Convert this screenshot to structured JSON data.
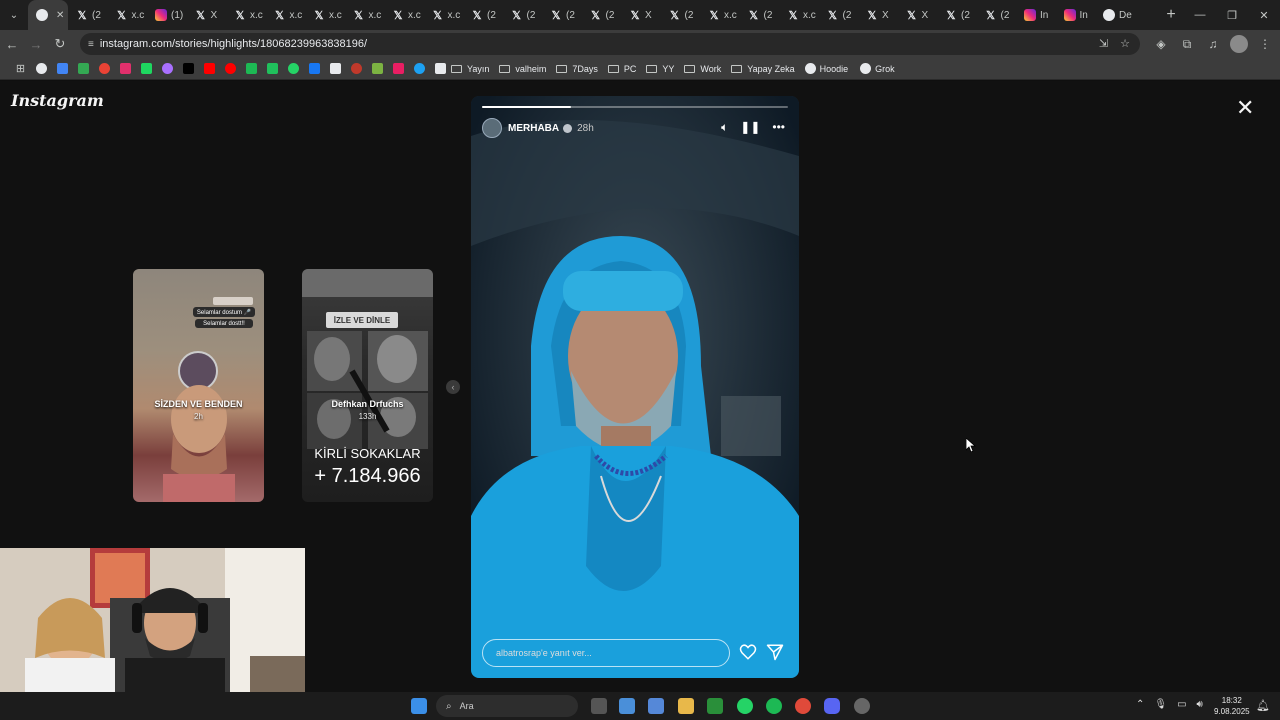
{
  "browser": {
    "tabs": [
      {
        "icon": "ch",
        "label": ""
      },
      {
        "icon": "x",
        "label": "(2"
      },
      {
        "icon": "x",
        "label": "x.c"
      },
      {
        "icon": "ig",
        "label": "(1)"
      },
      {
        "icon": "x",
        "label": "X"
      },
      {
        "icon": "x",
        "label": "x.c"
      },
      {
        "icon": "x",
        "label": "x.c"
      },
      {
        "icon": "x",
        "label": "x.c"
      },
      {
        "icon": "x",
        "label": "x.c"
      },
      {
        "icon": "x",
        "label": "x.c"
      },
      {
        "icon": "x",
        "label": "x.c"
      },
      {
        "icon": "x",
        "label": "(2"
      },
      {
        "icon": "x",
        "label": "(2"
      },
      {
        "icon": "x",
        "label": "(2"
      },
      {
        "icon": "x",
        "label": "(2"
      },
      {
        "icon": "x",
        "label": "X"
      },
      {
        "icon": "x",
        "label": "(2"
      },
      {
        "icon": "x",
        "label": "x.c"
      },
      {
        "icon": "x",
        "label": "(2"
      },
      {
        "icon": "x",
        "label": "x.c"
      },
      {
        "icon": "x",
        "label": "(2"
      },
      {
        "icon": "x",
        "label": "X"
      },
      {
        "icon": "x",
        "label": "X"
      },
      {
        "icon": "x",
        "label": "(2"
      },
      {
        "icon": "x",
        "label": "(2"
      },
      {
        "icon": "ig",
        "label": "In"
      },
      {
        "icon": "ig",
        "label": "In"
      },
      {
        "icon": "ch",
        "label": "De"
      }
    ],
    "url_site": "≡",
    "url": "instagram.com/stories/highlights/18068239963838196/",
    "bookmarks": {
      "folders": [
        "Yayın",
        "valheim",
        "7Days",
        "PC",
        "YY",
        "Work",
        "Yapay Zeka"
      ],
      "links": [
        "Hoodie",
        "Grok"
      ]
    }
  },
  "instagram": {
    "logo": "Instagram",
    "previews": [
      {
        "title": "SİZDEN VE BENDEN",
        "time": "2h",
        "tag1": "Selamlar dostum 🎤",
        "tag2": "Selamlar dostt!!"
      },
      {
        "title": "Defhkan Drfuchs",
        "time": "133h",
        "banner": "İZLE VE DİNLE",
        "big1": "KİRLİ SOKAKLAR",
        "big2": "+ 7.184.966"
      }
    ],
    "story": {
      "username": "MERHABA",
      "time": "28h",
      "progress": 0.29,
      "reply_placeholder": "albatrosrap'e yanıt ver..."
    }
  },
  "taskbar": {
    "search": "Ara",
    "time": "18:32",
    "date": "9.08.2025"
  },
  "colors": {
    "story_bg": "#1d2a35",
    "hoodie": "#2aa4d9",
    "page_bg": "#111111"
  }
}
